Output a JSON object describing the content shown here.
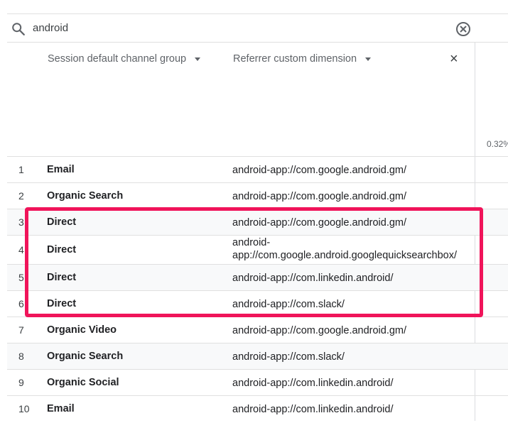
{
  "search": {
    "value": "android"
  },
  "columns": {
    "channel": "Session default channel group",
    "referrer": "Referrer custom dimension"
  },
  "metric_percent": "0.32%",
  "rows": [
    {
      "num": "1",
      "channel": "Email",
      "referrer": "android-app://com.google.android.gm/"
    },
    {
      "num": "2",
      "channel": "Organic Search",
      "referrer": "android-app://com.google.android.gm/"
    },
    {
      "num": "3",
      "channel": "Direct",
      "referrer": "android-app://com.google.android.gm/"
    },
    {
      "num": "4",
      "channel": "Direct",
      "referrer": "android-app://com.google.android.googlequicksearchbox/"
    },
    {
      "num": "5",
      "channel": "Direct",
      "referrer": "android-app://com.linkedin.android/"
    },
    {
      "num": "6",
      "channel": "Direct",
      "referrer": "android-app://com.slack/"
    },
    {
      "num": "7",
      "channel": "Organic Video",
      "referrer": "android-app://com.google.android.gm/"
    },
    {
      "num": "8",
      "channel": "Organic Search",
      "referrer": "android-app://com.slack/"
    },
    {
      "num": "9",
      "channel": "Organic Social",
      "referrer": "android-app://com.linkedin.android/"
    },
    {
      "num": "10",
      "channel": "Email",
      "referrer": "android-app://com.linkedin.android/"
    }
  ],
  "highlight_color": "#f0145a"
}
